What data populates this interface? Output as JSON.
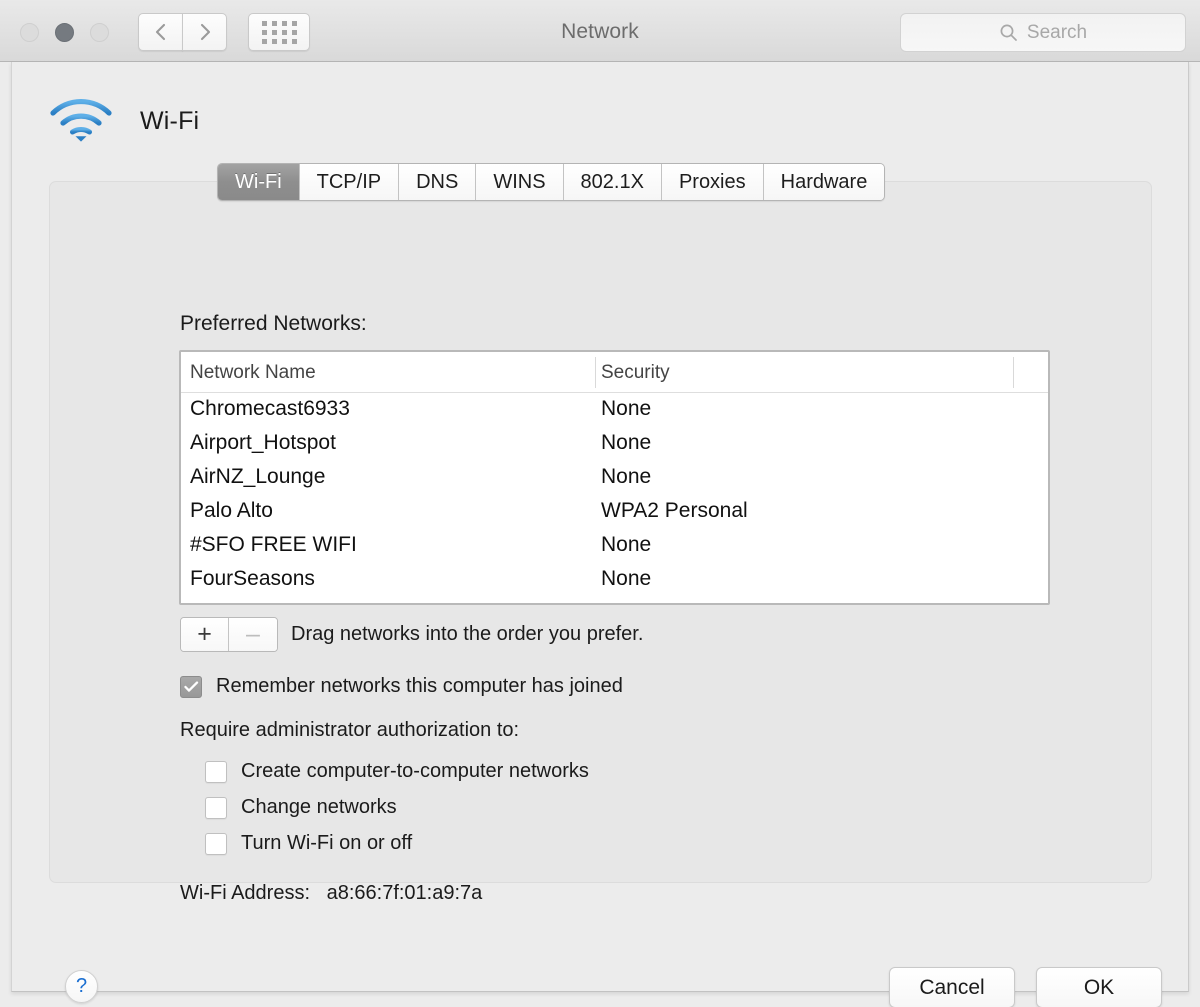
{
  "window": {
    "title": "Network",
    "traffic_lights": [
      "close",
      "minimize",
      "zoom"
    ]
  },
  "toolbar": {
    "back_icon": "chevron-left-icon",
    "forward_icon": "chevron-right-icon",
    "grid_icon": "show-all-grid-icon",
    "search": {
      "icon": "search-icon",
      "placeholder": "Search",
      "value": ""
    }
  },
  "service": {
    "icon": "wifi-icon",
    "name": "Wi-Fi"
  },
  "tabs": [
    {
      "label": "Wi-Fi",
      "selected": true
    },
    {
      "label": "TCP/IP",
      "selected": false
    },
    {
      "label": "DNS",
      "selected": false
    },
    {
      "label": "WINS",
      "selected": false
    },
    {
      "label": "802.1X",
      "selected": false
    },
    {
      "label": "Proxies",
      "selected": false
    },
    {
      "label": "Hardware",
      "selected": false
    }
  ],
  "preferred_networks": {
    "label": "Preferred Networks:",
    "columns": [
      "Network Name",
      "Security"
    ],
    "rows": [
      {
        "name": "Chromecast6933",
        "security": "None"
      },
      {
        "name": "Airport_Hotspot",
        "security": "None"
      },
      {
        "name": "AirNZ_Lounge",
        "security": "None"
      },
      {
        "name": "Palo Alto",
        "security": "WPA2 Personal"
      },
      {
        "name": "#SFO FREE WIFI",
        "security": "None"
      },
      {
        "name": "FourSeasons",
        "security": "None"
      }
    ],
    "add_label": "+",
    "remove_label": "–",
    "remove_disabled": true,
    "drag_note": "Drag networks into the order you prefer."
  },
  "options": {
    "remember": {
      "label": "Remember networks this computer has joined",
      "checked": true
    },
    "require_label": "Require administrator authorization to:",
    "admin_items": [
      {
        "label": "Create computer-to-computer networks",
        "checked": false
      },
      {
        "label": "Change networks",
        "checked": false
      },
      {
        "label": "Turn Wi-Fi on or off",
        "checked": false
      }
    ]
  },
  "hardware": {
    "address_label": "Wi-Fi Address:",
    "address_value": "a8:66:7f:01:a9:7a"
  },
  "footer": {
    "help_label": "?",
    "cancel_label": "Cancel",
    "ok_label": "OK"
  },
  "colors": {
    "accent_blue": "#1b6fd1",
    "wifi_blue": "#3e9ce0",
    "selected_tab": "#8e8e8e",
    "window_bg": "#ececec"
  }
}
